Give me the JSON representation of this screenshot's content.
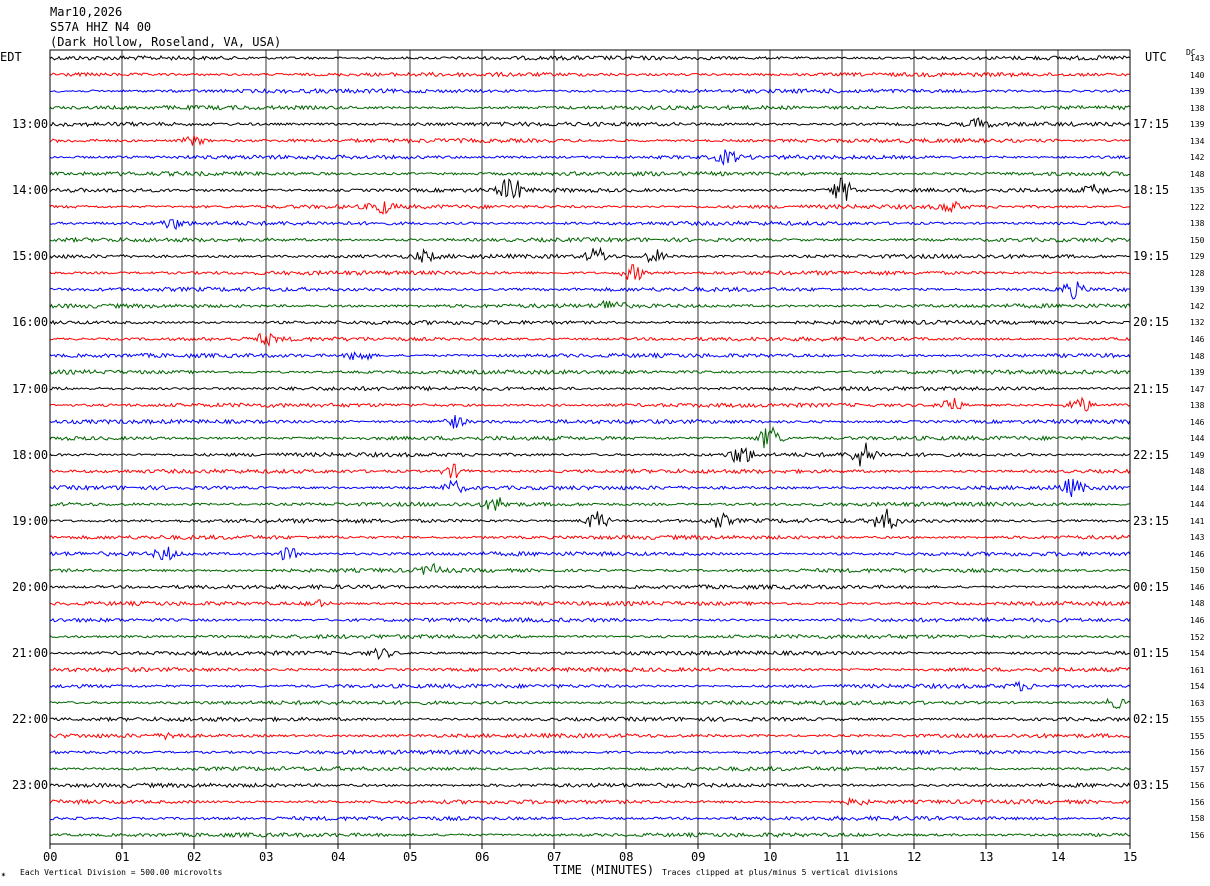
{
  "header": {
    "date": "Mar10,2026",
    "station": "S57A HHZ N4 00",
    "location": "(Dark Hollow, Roseland, VA, USA)",
    "left_tz": "EDT",
    "right_tz": "UTC",
    "dc_label": "DC"
  },
  "footer": {
    "scale_note": "Each Vertical Division =  500.00 microvolts",
    "clip_note": "Traces clipped at plus/minus 5 vertical divisions",
    "logo_mark": "✶"
  },
  "chart_data": {
    "type": "line",
    "title": "",
    "xlabel": "TIME (MINUTES)",
    "ylabel": "",
    "xlim": [
      0,
      15
    ],
    "x_ticks": [
      "00",
      "01",
      "02",
      "03",
      "04",
      "05",
      "06",
      "07",
      "08",
      "09",
      "10",
      "11",
      "12",
      "13",
      "14",
      "15"
    ],
    "grid": true,
    "trace_colors": [
      "#000000",
      "#ff0000",
      "#0000ff",
      "#006600"
    ],
    "left_hour_labels": [
      "13:00",
      "14:00",
      "15:00",
      "16:00",
      "17:00",
      "18:00",
      "19:00",
      "20:00",
      "21:00",
      "22:00",
      "23:00"
    ],
    "right_hour_labels": [
      "17:15",
      "18:15",
      "19:15",
      "20:15",
      "21:15",
      "22:15",
      "23:15",
      "00:15",
      "01:15",
      "02:15",
      "03:15"
    ],
    "dc_offsets": [
      143,
      140,
      139,
      138,
      139,
      134,
      142,
      148,
      135,
      122,
      138,
      150,
      129,
      128,
      139,
      142,
      132,
      146,
      148,
      139,
      147,
      138,
      146,
      144,
      149,
      148,
      144,
      144,
      141,
      143,
      146,
      150,
      146,
      148,
      146,
      152,
      154,
      161,
      154,
      163,
      155,
      155,
      156,
      157,
      156,
      156,
      158,
      156
    ],
    "events": [
      {
        "row": 4,
        "minute": 12.9,
        "strength": 3
      },
      {
        "row": 5,
        "minute": 2.0,
        "strength": 3
      },
      {
        "row": 6,
        "minute": 9.4,
        "strength": 4
      },
      {
        "row": 8,
        "minute": 6.4,
        "strength": 8
      },
      {
        "row": 8,
        "minute": 11.0,
        "strength": 8
      },
      {
        "row": 8,
        "minute": 14.5,
        "strength": 3
      },
      {
        "row": 9,
        "minute": 4.6,
        "strength": 4
      },
      {
        "row": 9,
        "minute": 12.5,
        "strength": 3
      },
      {
        "row": 10,
        "minute": 1.7,
        "strength": 3
      },
      {
        "row": 12,
        "minute": 5.2,
        "strength": 3
      },
      {
        "row": 12,
        "minute": 7.6,
        "strength": 5
      },
      {
        "row": 12,
        "minute": 8.4,
        "strength": 4
      },
      {
        "row": 13,
        "minute": 8.1,
        "strength": 5
      },
      {
        "row": 14,
        "minute": 14.2,
        "strength": 5
      },
      {
        "row": 15,
        "minute": 7.8,
        "strength": 4
      },
      {
        "row": 17,
        "minute": 3.0,
        "strength": 3
      },
      {
        "row": 18,
        "minute": 4.3,
        "strength": 4
      },
      {
        "row": 21,
        "minute": 12.5,
        "strength": 5
      },
      {
        "row": 21,
        "minute": 14.3,
        "strength": 5
      },
      {
        "row": 22,
        "minute": 5.6,
        "strength": 4
      },
      {
        "row": 23,
        "minute": 10.0,
        "strength": 8
      },
      {
        "row": 24,
        "minute": 9.6,
        "strength": 6
      },
      {
        "row": 24,
        "minute": 11.3,
        "strength": 8
      },
      {
        "row": 25,
        "minute": 5.6,
        "strength": 4
      },
      {
        "row": 26,
        "minute": 5.6,
        "strength": 4
      },
      {
        "row": 26,
        "minute": 14.2,
        "strength": 5
      },
      {
        "row": 27,
        "minute": 6.2,
        "strength": 4
      },
      {
        "row": 28,
        "minute": 7.6,
        "strength": 6
      },
      {
        "row": 28,
        "minute": 9.3,
        "strength": 4
      },
      {
        "row": 28,
        "minute": 11.6,
        "strength": 8
      },
      {
        "row": 30,
        "minute": 1.6,
        "strength": 4
      },
      {
        "row": 30,
        "minute": 3.3,
        "strength": 4
      },
      {
        "row": 31,
        "minute": 5.3,
        "strength": 3
      },
      {
        "row": 33,
        "minute": 3.7,
        "strength": 2
      },
      {
        "row": 36,
        "minute": 4.6,
        "strength": 3
      },
      {
        "row": 38,
        "minute": 13.5,
        "strength": 2
      },
      {
        "row": 39,
        "minute": 14.8,
        "strength": 3
      },
      {
        "row": 41,
        "minute": 1.7,
        "strength": 2
      },
      {
        "row": 45,
        "minute": 11.2,
        "strength": 2
      }
    ]
  }
}
